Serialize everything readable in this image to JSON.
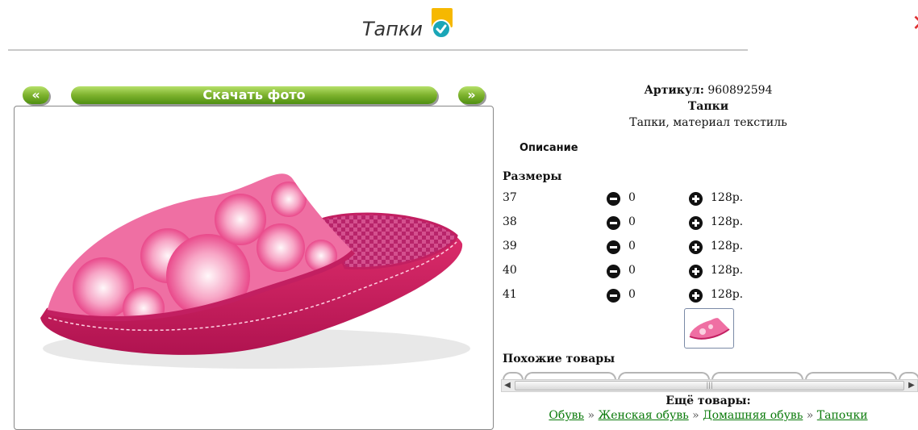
{
  "header": {
    "title": "Тапки"
  },
  "nav": {
    "prev_label": "«",
    "download_label": "Скачать фото",
    "next_label": "»"
  },
  "product": {
    "article_label": "Артикул:",
    "article_value": "960892594",
    "name": "Тапки",
    "short_desc": "Тапки, материал текстиль"
  },
  "description_tab": "Описание",
  "sizes": {
    "heading": "Размеры",
    "rows": [
      {
        "size": "37",
        "qty": "0",
        "price": "128р."
      },
      {
        "size": "38",
        "qty": "0",
        "price": "128р."
      },
      {
        "size": "39",
        "qty": "0",
        "price": "128р."
      },
      {
        "size": "40",
        "qty": "0",
        "price": "128р."
      },
      {
        "size": "41",
        "qty": "0",
        "price": "128р."
      }
    ]
  },
  "similar": {
    "heading": "Похожие товары"
  },
  "more": {
    "heading": "Ещё товары:",
    "breadcrumbs": [
      "Обувь",
      "Женская обувь",
      "Домашняя обувь",
      "Тапочки"
    ],
    "separator": "»"
  },
  "colors": {
    "accent_green": "#6aa622",
    "link_green": "#0a7a0a",
    "slipper_pink": "#e8478a"
  }
}
